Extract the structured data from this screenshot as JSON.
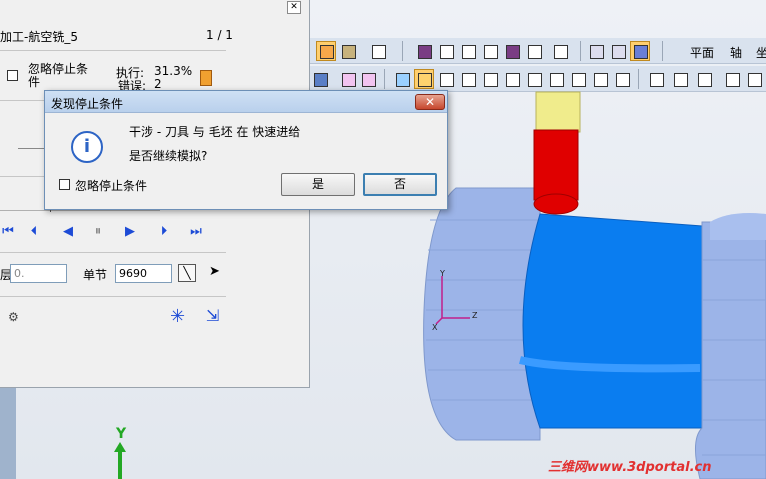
{
  "panel": {
    "title": "加工-航空铣_5",
    "page": "1 / 1",
    "ignore_stop_label": "忽略停止条件",
    "exec_label": "执行:",
    "exec_value": "31.3%",
    "error_label": "错误:",
    "error_value": "2",
    "layer_label": "层",
    "layer_value": "0.",
    "block_label": "单节",
    "block_value": "9690",
    "progress_fraction": 0.313
  },
  "toolbar": {
    "plane_label": "平面",
    "axis_label": "轴",
    "coord_label": "坐"
  },
  "dialog": {
    "title": "发现停止条件",
    "message": "干涉 - 刀具 与 毛坯 在 快速进给",
    "question": "是否继续模拟?",
    "ignore_label": "忽略停止条件",
    "yes_label": "是",
    "no_label": "否",
    "close_glyph": "✕"
  },
  "viewport": {
    "triad_x_label": "X",
    "triad_y_label": "Y",
    "triad_z_label": "Z",
    "axis_y_label": "Y"
  },
  "watermark": "三维网www.3dportal.cn",
  "colors": {
    "workpiece": "#9cb4e8",
    "cut_region": "#0a7df0",
    "tool_holder": "#f0ec8c",
    "tool_cutter": "#e00000"
  }
}
